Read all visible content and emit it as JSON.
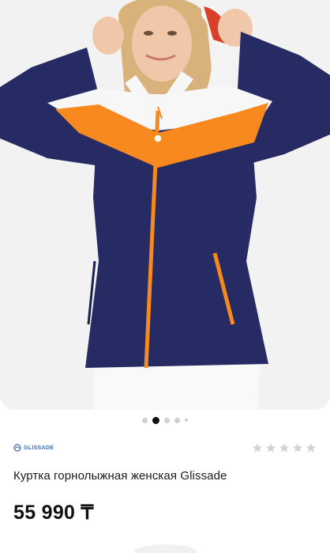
{
  "product": {
    "brand": "GLISSADE",
    "title": "Куртка горнолыжная женская Glissade",
    "price": "55 990 ₸",
    "rating": {
      "value": 0,
      "max": 5
    }
  },
  "gallery": {
    "image_count": 5,
    "active_index": 1
  },
  "colors": {
    "navy": "#262c63",
    "orange": "#f7891f",
    "white": "#f7f7f7",
    "background": "#f2f2f3",
    "star_empty": "#d3d3d3"
  },
  "icons": {
    "brand_logo": "glissade-logo-icon",
    "star": "star-icon"
  }
}
